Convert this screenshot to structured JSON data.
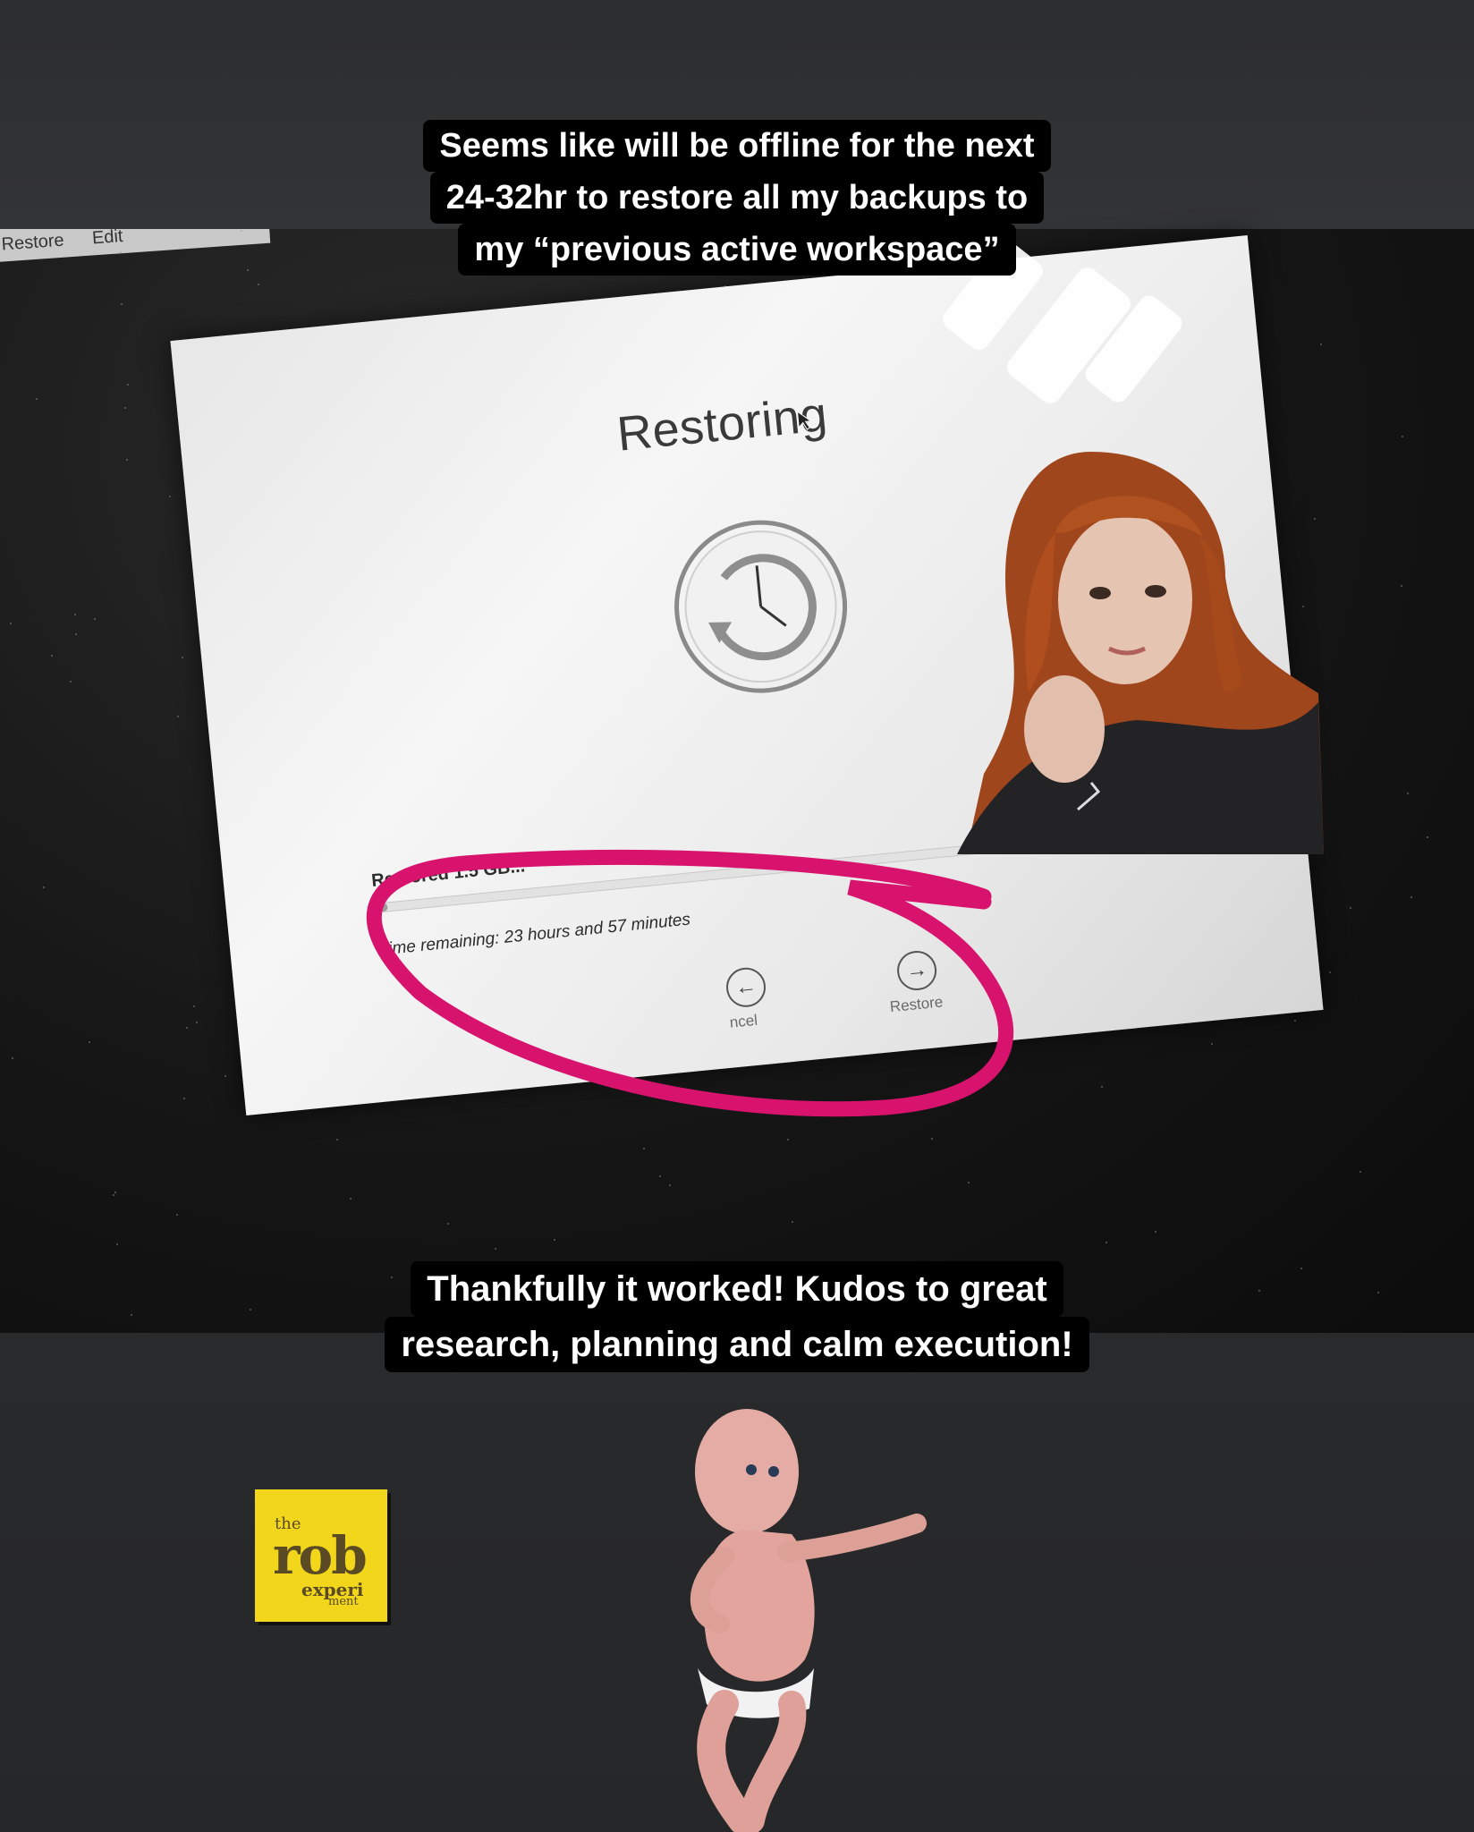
{
  "captions": {
    "top_lines": [
      "Seems like will be offline for the next",
      "24-32hr to restore all my backups to",
      "my “previous active workspace”"
    ],
    "bottom_lines": [
      "Thankfully it worked! Kudos to great",
      "research, planning and calm execution!"
    ]
  },
  "menubar": {
    "items": [
      "Restore",
      "Edit"
    ]
  },
  "restore_window": {
    "title": "Restoring",
    "status": "Restored 1.5 GB...",
    "progress_fraction": 0.02,
    "time_remaining": "Time remaining: 23 hours and 57 minutes",
    "cancel_label": "ncel",
    "restore_label": "Restore"
  },
  "logo": {
    "the": "the",
    "rob": "rob",
    "expe": "experi",
    "ment": "ment"
  },
  "colors": {
    "highlight": "#d8136e",
    "logo_bg": "#f2d61c",
    "caption_bg": "#000000"
  },
  "icons": [
    "time-machine-clock-icon",
    "back-arrow-icon",
    "forward-arrow-icon",
    "mouse-cursor-icon"
  ]
}
